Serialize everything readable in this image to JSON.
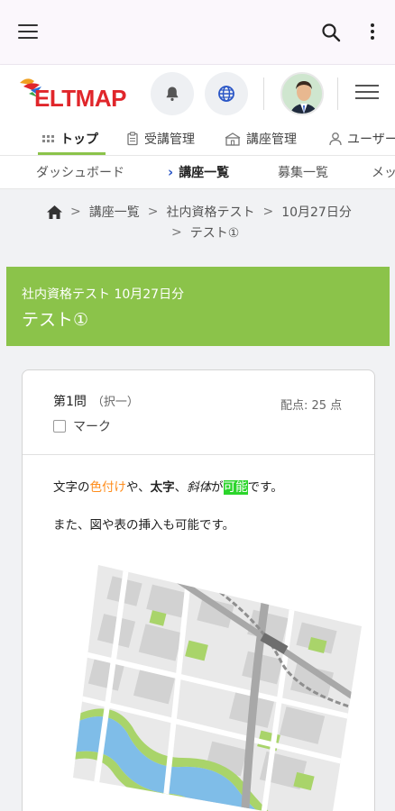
{
  "site": {
    "logo_text": "ELTMAP"
  },
  "main_nav": [
    {
      "label": "トップ",
      "icon": "grid-icon"
    },
    {
      "label": "受講管理",
      "icon": "clipboard-icon"
    },
    {
      "label": "講座管理",
      "icon": "school-icon"
    },
    {
      "label": "ユーザー",
      "icon": "user-icon"
    }
  ],
  "sub_nav": [
    {
      "label": "ダッシュボード"
    },
    {
      "label": "講座一覧"
    },
    {
      "label": "募集一覧"
    },
    {
      "label": "メッ"
    }
  ],
  "breadcrumb": {
    "sep": ">",
    "items": [
      "講座一覧",
      "社内資格テスト",
      "10月27日分",
      "テスト①"
    ]
  },
  "banner": {
    "subtitle": "社内資格テスト 10月27日分",
    "title": "テスト①"
  },
  "question": {
    "number": "第1問",
    "kind": "（択一）",
    "points": "配点: 25 点",
    "mark_label": "マーク",
    "line1": {
      "p1": "文字の",
      "p2": "色付け",
      "p3": "や、",
      "p4": "太字",
      "p5": "、",
      "p6": "斜体",
      "p7": "が",
      "p8": "可能",
      "p9": "です。"
    },
    "line2": "また、図や表の挿入も可能です。"
  },
  "colors": {
    "accent_green": "#8bc34a",
    "logo_red": "#e0262b",
    "orange_text": "#ff8c1a",
    "highlight": "#2bd52b",
    "subnav_chevron": "#2a56c6"
  }
}
